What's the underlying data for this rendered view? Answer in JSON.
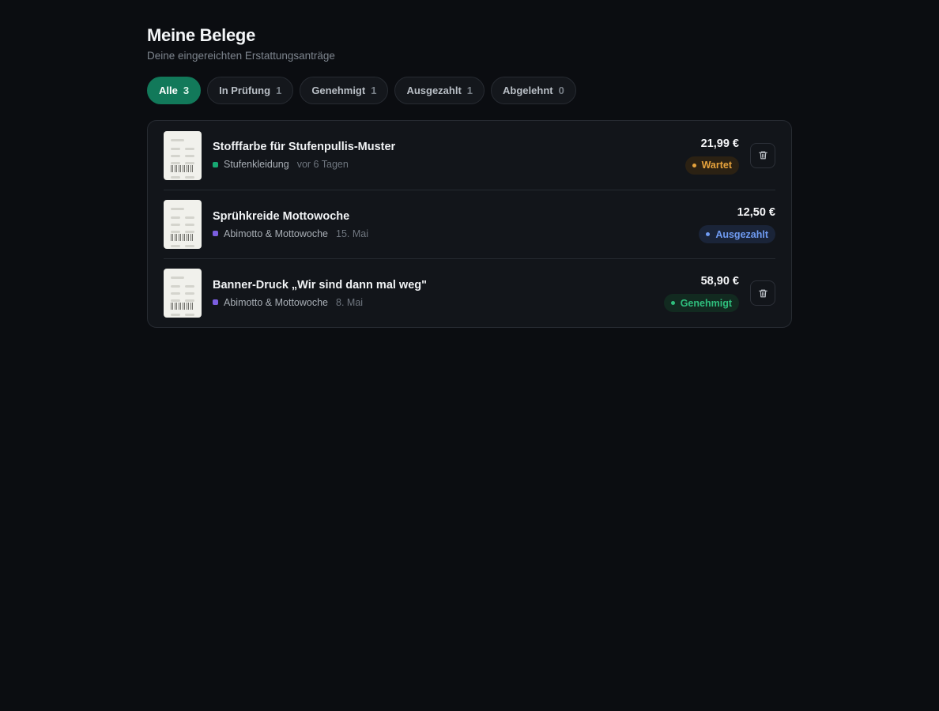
{
  "header": {
    "title": "Meine Belege",
    "subtitle": "Deine eingereichten Erstattungsanträge"
  },
  "filters": [
    {
      "label": "Alle",
      "count": "3",
      "active": true
    },
    {
      "label": "In Prüfung",
      "count": "1",
      "active": false
    },
    {
      "label": "Genehmigt",
      "count": "1",
      "active": false
    },
    {
      "label": "Ausgezahlt",
      "count": "1",
      "active": false
    },
    {
      "label": "Abgelehnt",
      "count": "0",
      "active": false
    }
  ],
  "receipts": [
    {
      "title": "Stofffarbe für Stufenpullis-Muster",
      "category": "Stufenkleidung",
      "category_color": "#17a872",
      "date": "vor 6 Tagen",
      "amount": "21,99 €",
      "status": "Wartet",
      "status_text_color": "#e6a23c",
      "status_bg": "#2b2113",
      "has_delete": true
    },
    {
      "title": "Sprühkreide Mottowoche",
      "category": "Abimotto & Mottowoche",
      "category_color": "#7b5ee0",
      "date": "15. Mai",
      "amount": "12,50 €",
      "status": "Ausgezahlt",
      "status_text_color": "#6f9bf2",
      "status_bg": "#1a2438",
      "has_delete": false
    },
    {
      "title": "Banner-Druck „Wir sind dann mal weg\"",
      "category": "Abimotto & Mottowoche",
      "category_color": "#7b5ee0",
      "date": "8. Mai",
      "amount": "58,90 €",
      "status": "Genehmigt",
      "status_text_color": "#2fbf7d",
      "status_bg": "#122a20",
      "has_delete": true
    }
  ],
  "icons": {
    "receipt": "receipt-thumbnail-icon",
    "delete": "trash-icon"
  }
}
